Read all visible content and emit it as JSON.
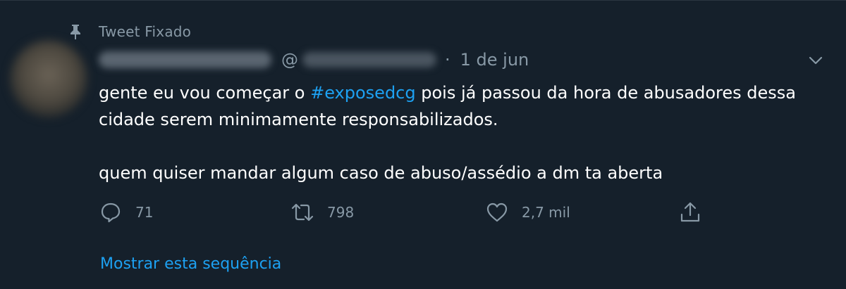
{
  "pinned": {
    "label": "Tweet Fixado",
    "icon": "pin-icon"
  },
  "author": {
    "handle_prefix": "@",
    "separator": "·",
    "date": "1 de jun"
  },
  "tweet": {
    "text_before_hashtag": "gente eu vou começar o ",
    "hashtag": "#exposedcg",
    "text_after_hashtag": " pois já passou da hora de abusadores dessa cidade serem minimamente responsabilizados.",
    "paragraph2": "quem quiser mandar algum caso de abuso/assédio a dm ta aberta"
  },
  "actions": {
    "reply": {
      "icon": "reply-icon",
      "count": "71"
    },
    "retweet": {
      "icon": "retweet-icon",
      "count": "798"
    },
    "like": {
      "icon": "heart-icon",
      "count": "2,7 mil"
    },
    "share": {
      "icon": "share-icon"
    }
  },
  "show_thread": "Mostrar esta sequência",
  "colors": {
    "background": "#15202b",
    "muted": "#8899a6",
    "accent": "#1da1f2",
    "text": "#ffffff"
  }
}
